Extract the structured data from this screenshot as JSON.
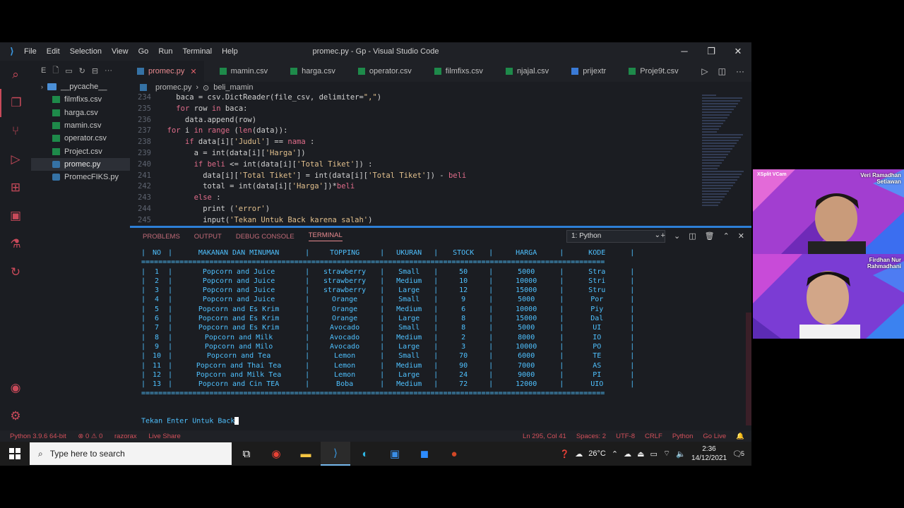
{
  "window": {
    "title": "promec.py - Gp - Visual Studio Code",
    "menu": [
      "File",
      "Edit",
      "Selection",
      "View",
      "Go",
      "Run",
      "Terminal",
      "Help"
    ]
  },
  "explorer": {
    "header": "E",
    "items": [
      {
        "name": "__pycache__",
        "type": "folder"
      },
      {
        "name": "filmfixs.csv",
        "type": "csv"
      },
      {
        "name": "harga.csv",
        "type": "csv"
      },
      {
        "name": "mamin.csv",
        "type": "csv"
      },
      {
        "name": "operator.csv",
        "type": "csv"
      },
      {
        "name": "Project.csv",
        "type": "csv"
      },
      {
        "name": "promec.py",
        "type": "py"
      },
      {
        "name": "PromecFIKS.py",
        "type": "py"
      }
    ]
  },
  "tabs": [
    {
      "label": "promec.py",
      "type": "py"
    },
    {
      "label": "mamin.csv",
      "type": "csv"
    },
    {
      "label": "harga.csv",
      "type": "csv"
    },
    {
      "label": "operator.csv",
      "type": "csv"
    },
    {
      "label": "filmfixs.csv",
      "type": "csv"
    },
    {
      "label": "njajal.csv",
      "type": "csv"
    },
    {
      "label": "prijextr",
      "type": "txt"
    },
    {
      "label": "Proje9t.csv",
      "type": "csv"
    }
  ],
  "breadcrumb": [
    "promec.py",
    "beli_mamin"
  ],
  "code": [
    {
      "ln": "234",
      "text": "    baca = csv.DictReader(file_csv, delimiter=\",\")"
    },
    {
      "ln": "235",
      "text": "    for row in baca:"
    },
    {
      "ln": "236",
      "text": "      data.append(row)"
    },
    {
      "ln": "237",
      "text": "  for i in range (len(data)):"
    },
    {
      "ln": "238",
      "text": "      if data[i]['Judul'] == nama :"
    },
    {
      "ln": "239",
      "text": "        a = int(data[i]['Harga'])"
    },
    {
      "ln": "240",
      "text": "        if beli <= int(data[i]['Total Tiket']) :"
    },
    {
      "ln": "241",
      "text": "          data[i]['Total Tiket'] = int(data[i]['Total Tiket']) - beli"
    },
    {
      "ln": "242",
      "text": "          total = int(data[i]['Harga'])*beli"
    },
    {
      "ln": "243",
      "text": "        else :"
    },
    {
      "ln": "244",
      "text": "          print ('error')"
    },
    {
      "ln": "245",
      "text": "          input('Tekan Untuk Back karena salah')"
    }
  ],
  "panel": {
    "tabs": [
      "PROBLEMS",
      "OUTPUT",
      "DEBUG CONSOLE",
      "TERMINAL"
    ],
    "terminal_select": "1: Python"
  },
  "table": {
    "headers": [
      "NO",
      "MAKANAN DAN MINUMAN",
      "TOPPING",
      "UKURAN",
      "STOCK",
      "HARGA",
      "KODE"
    ],
    "rows": [
      [
        "1",
        "Popcorn and Juice",
        "strawberry",
        "Small",
        "50",
        "5000",
        "Stra"
      ],
      [
        "2",
        "Popcorn and Juice",
        "strawberry",
        "Medium",
        "10",
        "10000",
        "Stri"
      ],
      [
        "3",
        "Popcorn and Juice",
        "strawberry",
        "Large",
        "12",
        "15000",
        "Stru"
      ],
      [
        "4",
        "Popcorn and Juice",
        "Orange",
        "Small",
        "9",
        "5000",
        "Por"
      ],
      [
        "5",
        "Popcorn and Es Krim",
        "Orange",
        "Medium",
        "6",
        "10000",
        "Piy"
      ],
      [
        "6",
        "Popcorn and Es Krim",
        "Orange",
        "Large",
        "8",
        "15000",
        "Dal"
      ],
      [
        "7",
        "Popcorn and Es Krim",
        "Avocado",
        "Small",
        "8",
        "5000",
        "UI"
      ],
      [
        "8",
        "Popcorn and Milk",
        "Avocado",
        "Medium",
        "2",
        "8000",
        "IO"
      ],
      [
        "9",
        "Popcorn and Milo",
        "Avocado",
        "Large",
        "3",
        "10000",
        "PO"
      ],
      [
        "10",
        "Popcorn and Tea",
        "Lemon",
        "Small",
        "70",
        "6000",
        "TE"
      ],
      [
        "11",
        "Popcorn and Thai Tea",
        "Lemon",
        "Medium",
        "90",
        "7000",
        "AS"
      ],
      [
        "12",
        "Popcorn and Milk Tea",
        "Lemon",
        "Large",
        "24",
        "9000",
        "PI"
      ],
      [
        "13",
        "Popcorn and Cin TEA",
        "Boba",
        "Medium",
        "72",
        "12000",
        "UIO"
      ]
    ]
  },
  "prompt": "Tekan Enter Untuk Back",
  "status": {
    "python": "Python 3.9.6 64-bit",
    "errors": "⊗ 0  ⚠ 0",
    "user": "razorax",
    "live": "Live Share",
    "position": "Ln 295, Col 41",
    "spaces": "Spaces: 2",
    "encoding": "UTF-8",
    "eol": "CRLF",
    "lang": "Python",
    "golive": "Go Live"
  },
  "taskbar": {
    "search_placeholder": "Type here to search",
    "weather": "26°C",
    "time": "2:36",
    "date": "14/12/2021",
    "notifications": "5"
  },
  "webcams": [
    {
      "label": "XSplit VCam",
      "name_line1": "Veri Ramadhan",
      "name_line2": "Setiawan"
    },
    {
      "label": "",
      "name_line1": "Firdhan Nur",
      "name_line2": "Rahmadhani"
    }
  ],
  "colors": {
    "accent": "#e06c8a",
    "terminal": "#4fc1ff",
    "sash": "#2d7fd6"
  }
}
